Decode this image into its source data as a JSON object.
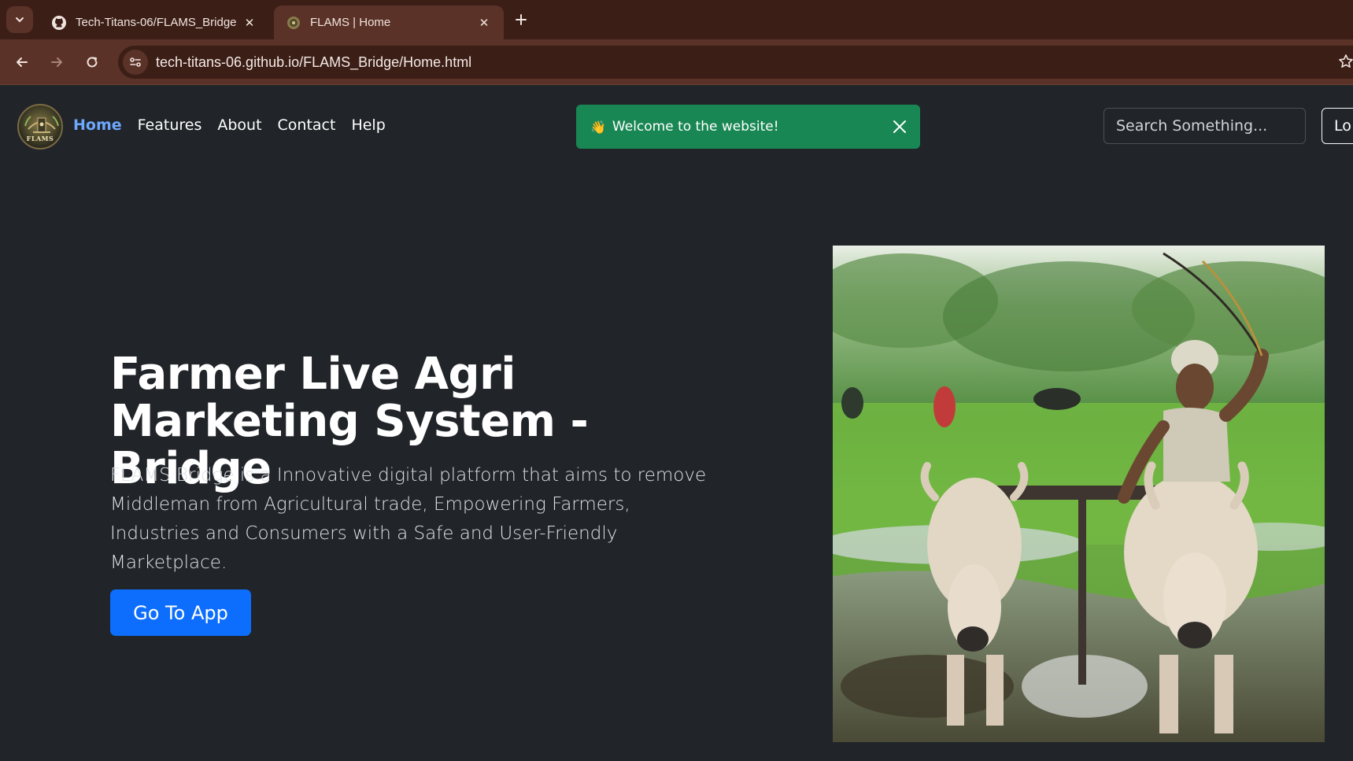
{
  "browser": {
    "tabs": [
      {
        "title": "Tech-Titans-06/FLAMS_Bridge",
        "favicon": "github-icon",
        "active": false
      },
      {
        "title": "FLAMS | Home",
        "favicon": "flams-favicon-icon",
        "active": true
      }
    ],
    "url": "tech-titans-06.github.io/FLAMS_Bridge/Home.html"
  },
  "navbar": {
    "logo_text": "FLAMS",
    "links": [
      {
        "label": "Home",
        "active": true
      },
      {
        "label": "Features",
        "active": false
      },
      {
        "label": "About",
        "active": false
      },
      {
        "label": "Contact",
        "active": false
      },
      {
        "label": "Help",
        "active": false
      }
    ],
    "search_placeholder": "Search Something...",
    "login_label": "Lo"
  },
  "toast": {
    "emoji": "👋",
    "message": "Welcome to the website!",
    "color": "#198754"
  },
  "hero": {
    "title": "Farmer Live Agri Marketing System - Bridge",
    "description": "FLAMS Bridge is a Innovative digital platform that aims to remove Middleman from Agricultural trade, Empowering Farmers, Industries and Consumers with a Safe and User-Friendly Marketplace.",
    "cta_label": "Go To App",
    "image_alt": "Farmer ploughing a paddy field with two oxen"
  },
  "colors": {
    "page_bg": "#212529",
    "active_link": "#6ea8fe",
    "primary": "#0d6efd",
    "chrome_tabbar": "#3b1f17",
    "chrome_toolbar": "#5a3227"
  }
}
